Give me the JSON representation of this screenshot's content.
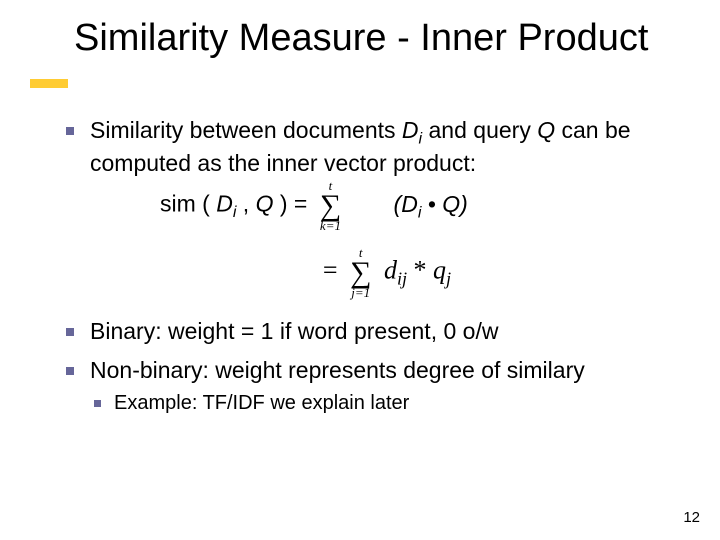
{
  "title": "Similarity Measure - Inner Product",
  "bullets": {
    "b1_prefix": "Similarity between documents ",
    "b1_di": "D",
    "b1_di_sub": "i",
    "b1_mid": " and query ",
    "b1_q": "Q",
    "b1_suffix": " can be computed as the inner vector product:",
    "formula_sim_left": "sim ( ",
    "formula_d": "D",
    "formula_i_sub": "i",
    "formula_commaq": " , ",
    "formula_q": "Q",
    "formula_eq": " ) = ",
    "sum1_top": "t",
    "sum1_bot": "k=1",
    "rhs_open": "(",
    "rhs_d": "D",
    "rhs_isub": "i",
    "rhs_dot": " • ",
    "rhs_q": "Q",
    "rhs_close": ")",
    "eq2_eq": "= ",
    "sum2_top": "t",
    "sum2_bot": "j=1",
    "eq2_d": "d",
    "eq2_ij": "ij",
    "eq2_star": " * ",
    "eq2_q": "q",
    "eq2_j": "j",
    "b2": "Binary: weight = 1 if word present, 0 o/w",
    "b3": "Non-binary: weight represents degree of similary",
    "b3_sub": "Example: TF/IDF we explain later"
  },
  "page_number": "12"
}
